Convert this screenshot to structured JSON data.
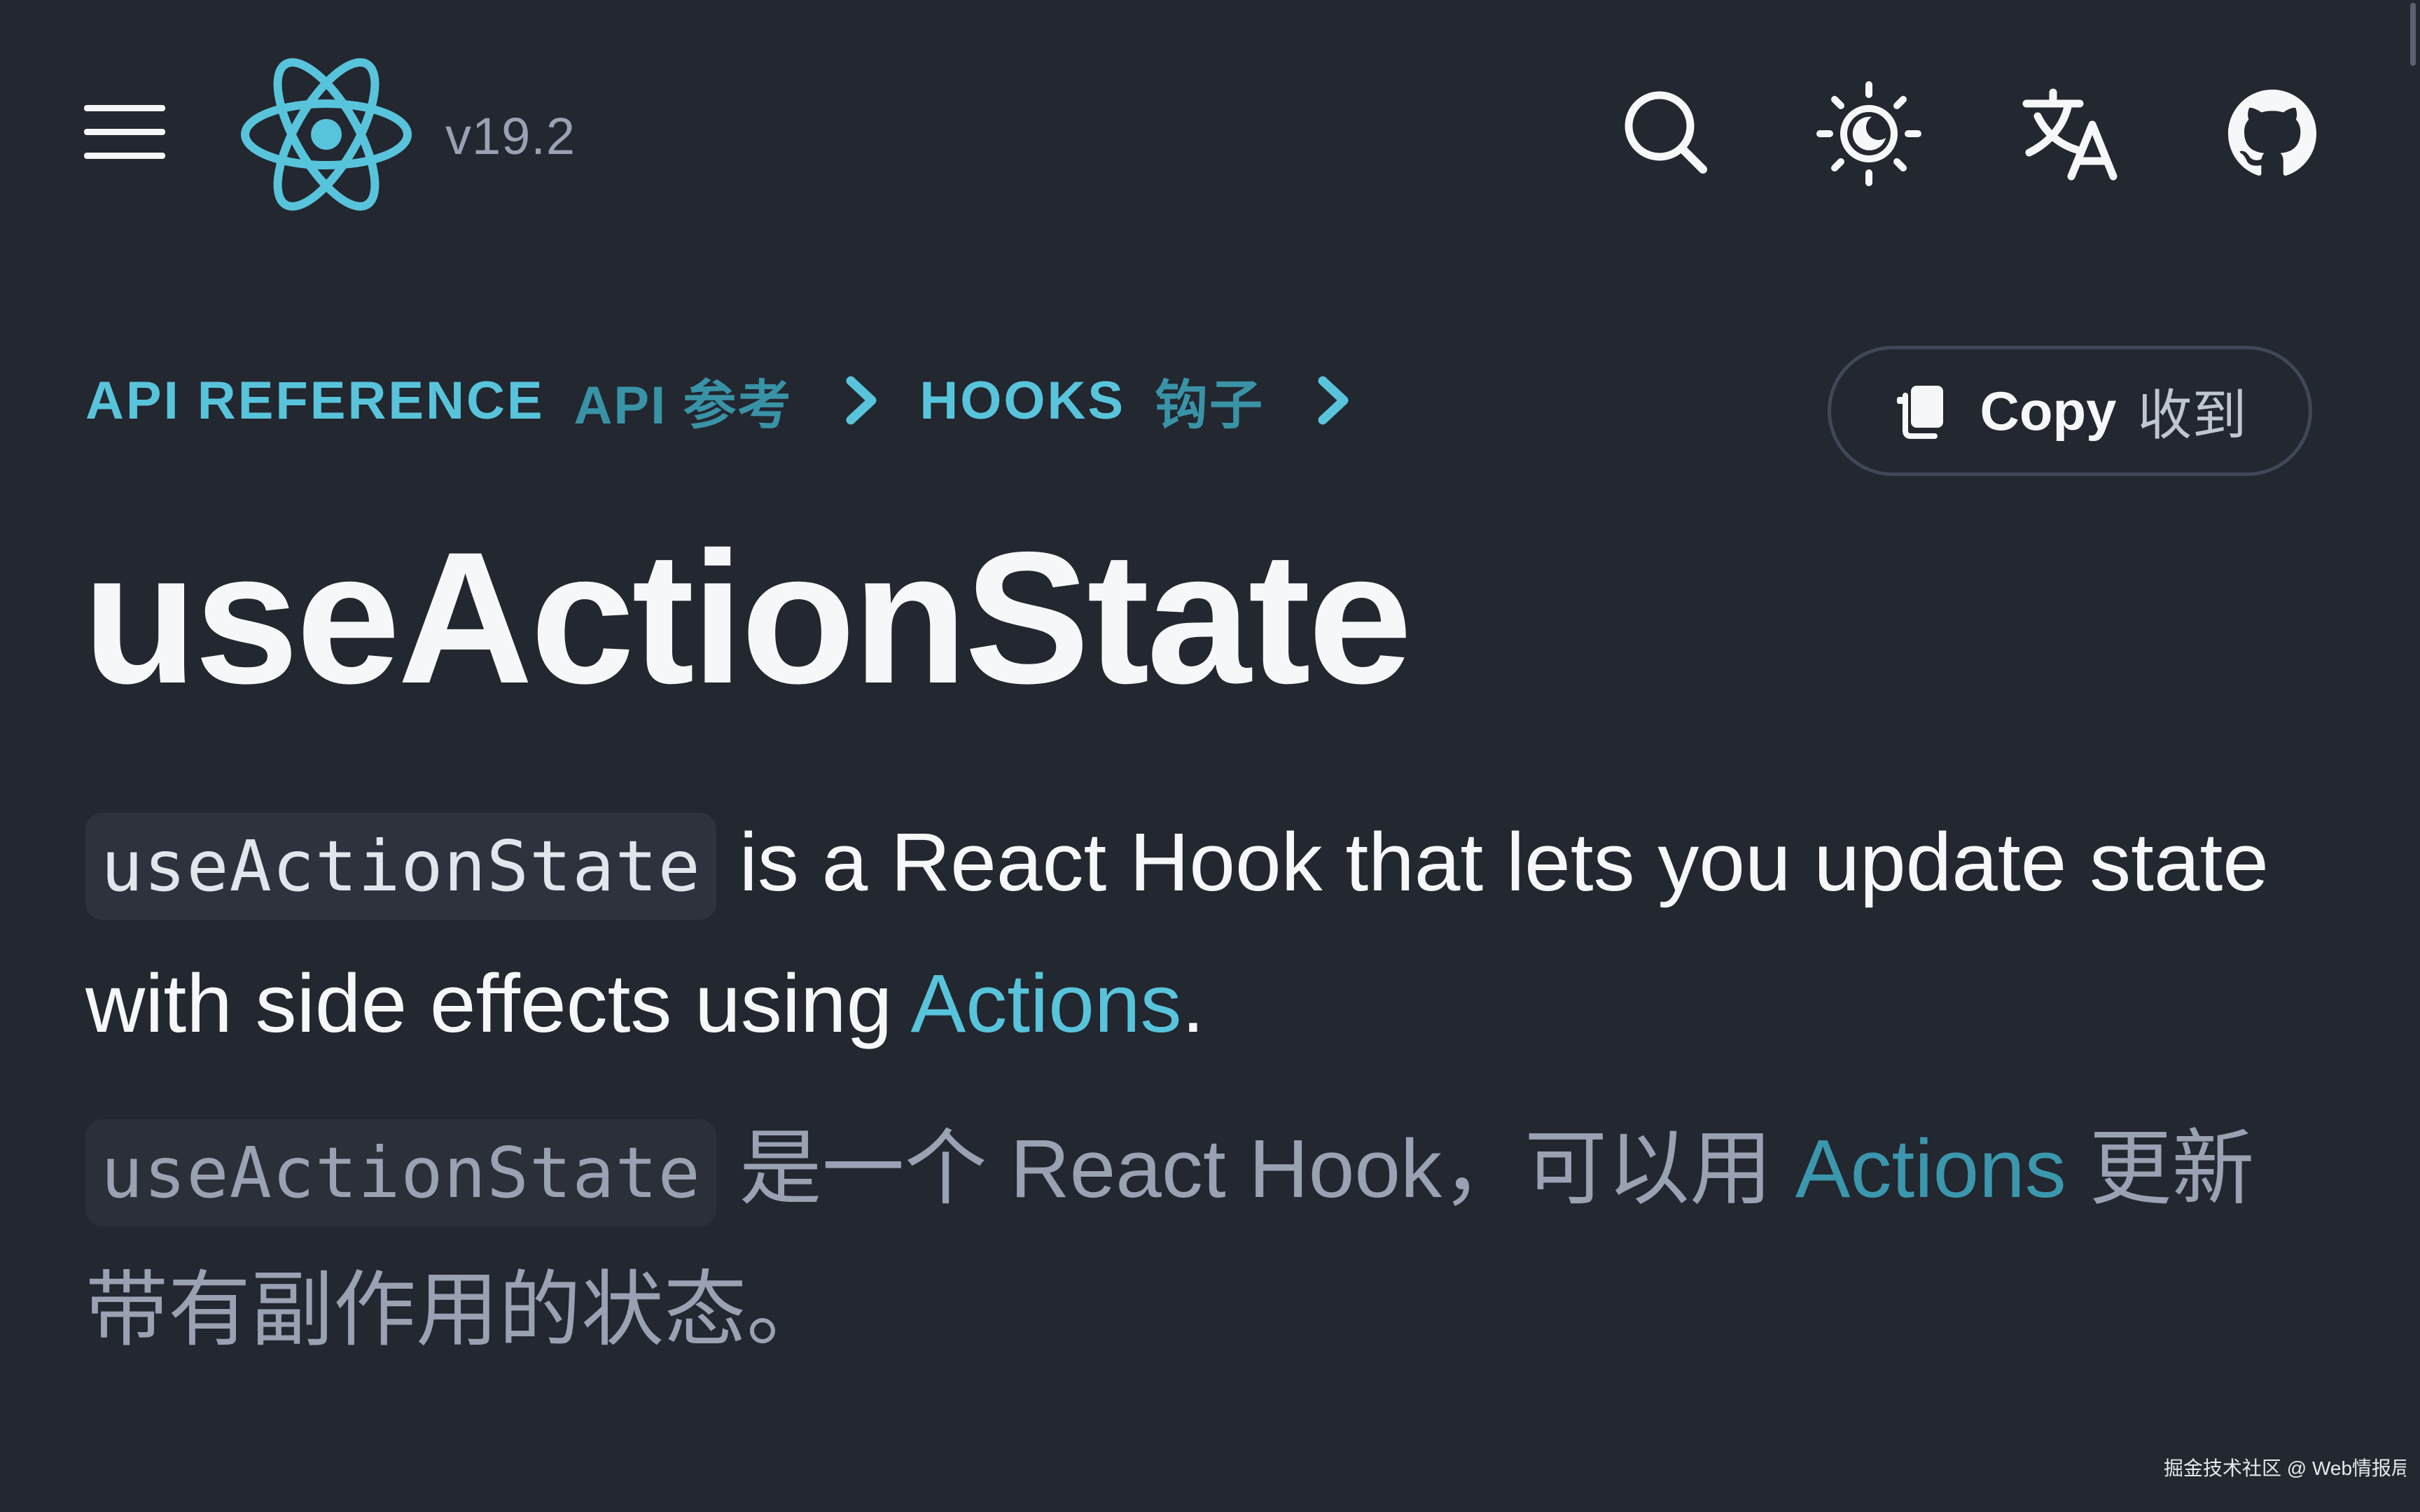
{
  "header": {
    "menu_icon": "hamburger-menu-icon",
    "logo_icon": "react-atom-logo-icon",
    "version": "v19.2",
    "actions": [
      "search-icon",
      "theme-toggle-icon",
      "translate-icon",
      "github-icon"
    ]
  },
  "breadcrumb": {
    "items": [
      {
        "label": "API REFERENCE",
        "translation": "API 参考"
      },
      {
        "label": "HOOKS",
        "translation": "钩子"
      }
    ]
  },
  "copy_button": {
    "label": "Copy",
    "translation": "收到",
    "icon": "copy-icon"
  },
  "page": {
    "title": "useActionState",
    "intro_en": {
      "code": "useActionState",
      "text": " is a React Hook that lets you update state with side effects using ",
      "link": "Actions",
      "end": "."
    },
    "intro_zh": {
      "code": "useActionState",
      "text": " 是一个 React Hook，可以用 ",
      "link": "Actions",
      "end": " 更新带有副作用的状态。"
    }
  },
  "watermark": "掘金技术社区 @ Web情报局",
  "colors": {
    "background": "#23272f",
    "accent": "#58c4dc",
    "text": "#f6f7f9",
    "muted": "#99a1b3"
  }
}
